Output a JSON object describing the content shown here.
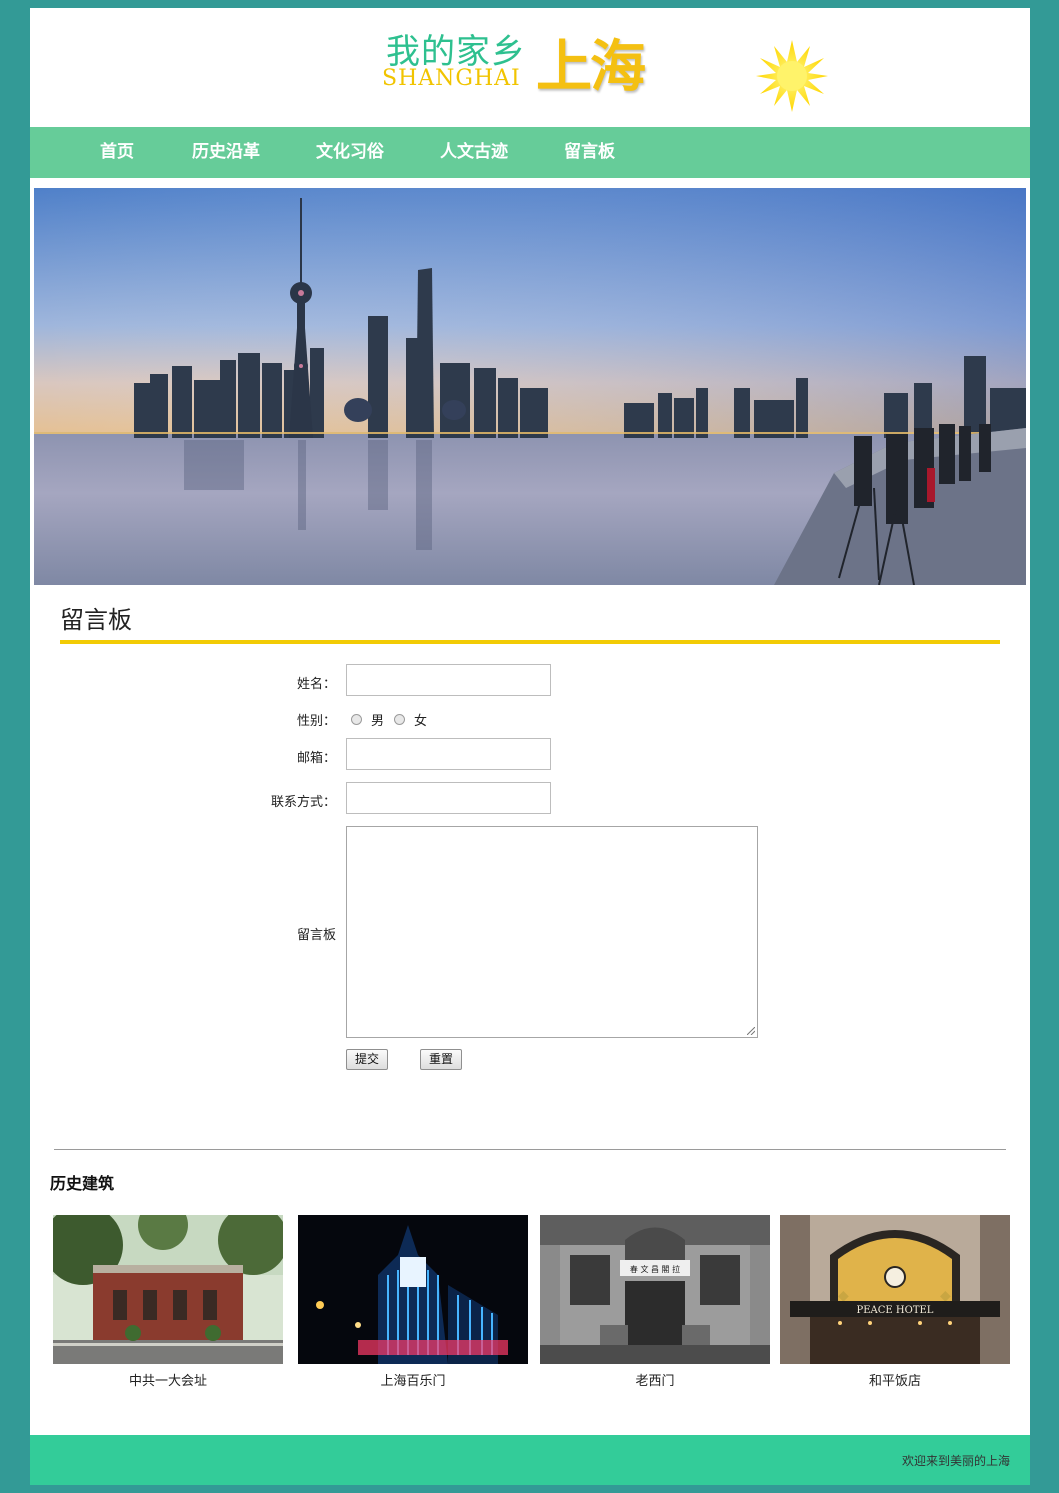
{
  "header": {
    "logo_cn": "我的家乡",
    "logo_en": "SHANGHAI",
    "logo_big": "上海"
  },
  "nav": {
    "items": [
      "首页",
      "历史沿革",
      "文化习俗",
      "人文古迹",
      "留言板"
    ]
  },
  "board": {
    "title": "留言板"
  },
  "form": {
    "name_label": "姓名：",
    "gender_label": "性别：",
    "gender_options": [
      "男",
      "女"
    ],
    "email_label": "邮箱：",
    "contact_label": "联系方式：",
    "message_label": "留言板",
    "submit_label": "提交",
    "reset_label": "重置"
  },
  "gallery": {
    "title": "历史建筑",
    "items": [
      {
        "caption": "中共一大会址"
      },
      {
        "caption": "上海百乐门"
      },
      {
        "caption": "老西门",
        "sign": "春 文 昌 閣 拉"
      },
      {
        "caption": "和平饭店",
        "sign": "PEACE HOTEL"
      }
    ]
  },
  "footer": {
    "text": "欢迎来到美丽的上海"
  }
}
